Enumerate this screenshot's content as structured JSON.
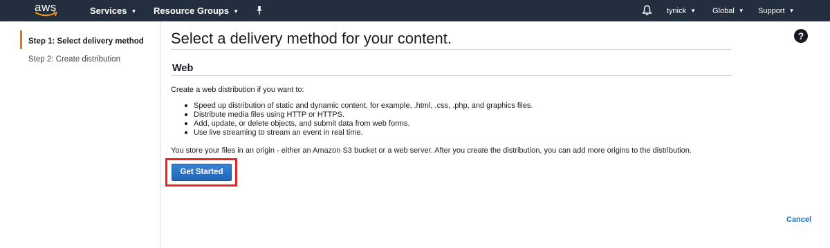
{
  "topnav": {
    "logo_text": "aws",
    "services_label": "Services",
    "resource_groups_label": "Resource Groups",
    "user_label": "tynick",
    "region_label": "Global",
    "support_label": "Support",
    "colors": {
      "background": "#232f3e",
      "text": "#ffffff"
    }
  },
  "sidebar": {
    "steps": [
      {
        "label": "Step 1: Select delivery method"
      },
      {
        "label": "Step 2: Create distribution"
      }
    ],
    "active_accent": "#ec7211"
  },
  "main": {
    "title": "Select a delivery method for your content.",
    "section_title": "Web",
    "intro": "Create a web distribution if you want to:",
    "bullets": [
      "Speed up distribution of static and dynamic content, for example, .html, .css, .php, and graphics files.",
      "Distribute media files using HTTP or HTTPS.",
      "Add, update, or delete objects, and submit data from web forms.",
      "Use live streaming to stream an event in real time."
    ],
    "origin_note": "You store your files in an origin - either an Amazon S3 bucket or a web server. After you create the distribution, you can add more origins to the distribution.",
    "get_started_label": "Get Started",
    "cancel_label": "Cancel",
    "help_glyph": "?"
  },
  "icons": {
    "logo": "aws-logo",
    "pin": "pin-icon",
    "bell": "bell-icon",
    "help": "help-icon"
  }
}
